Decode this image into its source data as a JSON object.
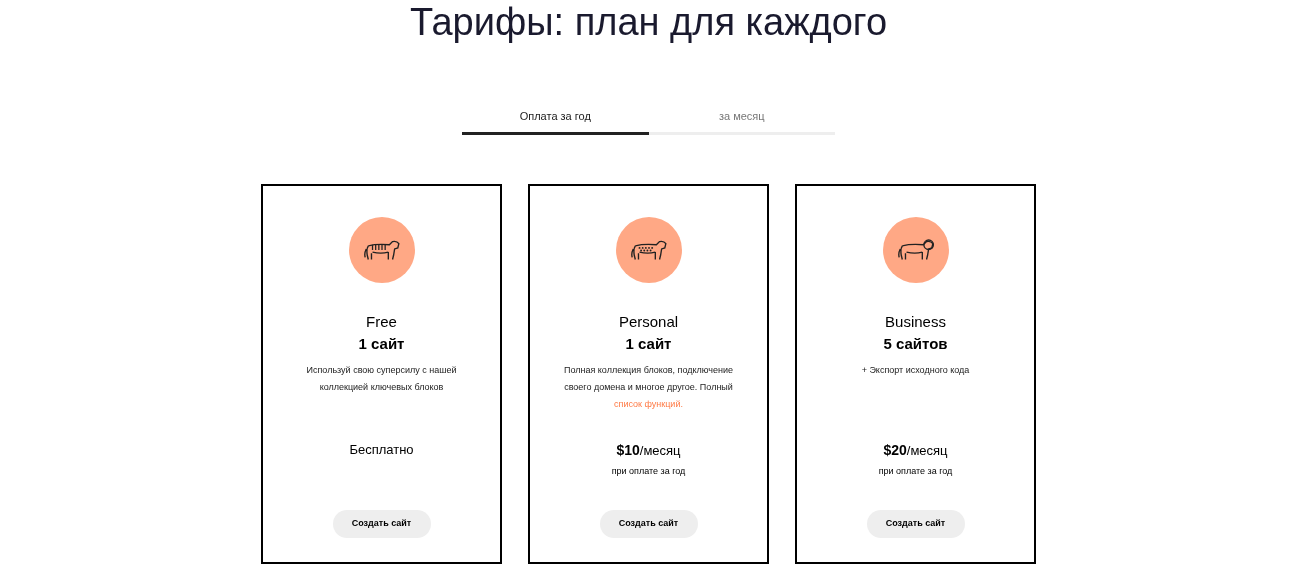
{
  "title": "Тарифы: план для каждого",
  "tabs": [
    {
      "label": "Оплата за год",
      "selected": true
    },
    {
      "label": "за месяц",
      "selected": false
    }
  ],
  "plans": [
    {
      "kind": "tiger",
      "name": "Free",
      "sites": "1 сайт",
      "description": "Используй свою суперсилу с нашей коллекцией ключевых блоков",
      "price": {
        "kind": "free",
        "text": "Бесплатно"
      },
      "button": "Создать сайт"
    },
    {
      "kind": "leopard",
      "name": "Personal",
      "sites": "1 сайт",
      "description": "Полная коллекция блоков, подключение своего домена и многое другое. Полный",
      "link": "список функций.",
      "price": {
        "kind": "paid",
        "amount": "$10",
        "period": "/месяц",
        "note": "при оплате за год"
      },
      "button": "Создать сайт"
    },
    {
      "kind": "lion",
      "name": "Business",
      "sites": "5 сайтов",
      "description": "+ Экспорт исходного кода",
      "price": {
        "kind": "paid",
        "amount": "$20",
        "period": "/месяц",
        "note": "при оплате за год"
      },
      "button": "Создать сайт"
    }
  ]
}
